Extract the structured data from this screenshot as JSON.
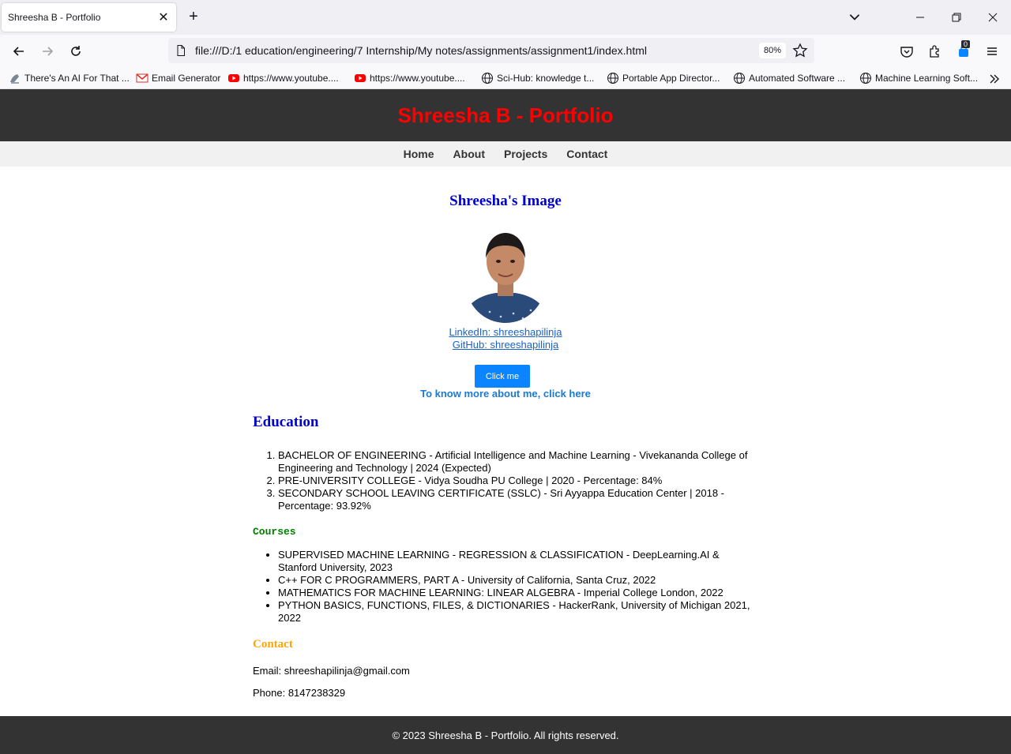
{
  "browser": {
    "tab_title": "Shreesha B - Portfolio",
    "url": "file:///D:/1 education/engineering/7 Internship/My notes/assignments/assignment1/index.html",
    "zoom": "80%",
    "extension_badge": "0",
    "bookmarks": [
      {
        "label": "There's An AI For That ...",
        "icon": "ai-icon"
      },
      {
        "label": "Email Generator",
        "icon": "gmail-icon"
      },
      {
        "label": "https://www.youtube....",
        "icon": "youtube-icon"
      },
      {
        "label": "https://www.youtube....",
        "icon": "youtube-icon"
      },
      {
        "label": "Sci-Hub: knowledge t...",
        "icon": "globe-icon"
      },
      {
        "label": "Portable App Director...",
        "icon": "globe-icon"
      },
      {
        "label": "Automated Software ...",
        "icon": "globe-icon"
      },
      {
        "label": "Machine Learning Soft...",
        "icon": "globe-icon"
      }
    ]
  },
  "page": {
    "header_title": "Shreesha B - Portfolio",
    "nav": [
      "Home",
      "About",
      "Projects",
      "Contact"
    ],
    "image_heading": "Shreesha's Image",
    "linkedin": "LinkedIn: shreeshapilinja",
    "github": "GitHub: shreeshapilinja",
    "click_button": "Click me",
    "know_more": "To know more about me, click here",
    "education_heading": "Education",
    "education": [
      "BACHELOR OF ENGINEERING - Artificial Intelligence and Machine Learning - Vivekananda College of Engineering and Technology | 2024 (Expected)",
      "PRE-UNIVERSITY COLLEGE - Vidya Soudha PU College | 2020 - Percentage: 84%",
      "SECONDARY SCHOOL LEAVING CERTIFICATE (SSLC) - Sri Ayyappa Education Center | 2018 - Percentage: 93.92%"
    ],
    "courses_heading": "Courses",
    "courses": [
      "SUPERVISED MACHINE LEARNING - REGRESSION & CLASSIFICATION - DeepLearning.AI & Stanford University, 2023",
      "C++ FOR C PROGRAMMERS, PART A - University of California, Santa Cruz, 2022",
      "MATHEMATICS FOR MACHINE LEARNING: LINEAR ALGEBRA - Imperial College London, 2022",
      "PYTHON BASICS, FUNCTIONS, FILES, & DICTIONARIES - HackerRank, University of Michigan 2021, 2022"
    ],
    "contact_heading": "Contact",
    "email": "Email: shreeshapilinja@gmail.com",
    "phone": "Phone: 8147238329",
    "footer": "© 2023 Shreesha B - Portfolio. All rights reserved."
  },
  "colors": {
    "header_bg": "#333333",
    "title_red": "#ff0000",
    "heading_blue": "#0000cd",
    "courses_green": "#008000",
    "contact_orange": "#ffa500",
    "button_blue": "#0a84ff"
  }
}
